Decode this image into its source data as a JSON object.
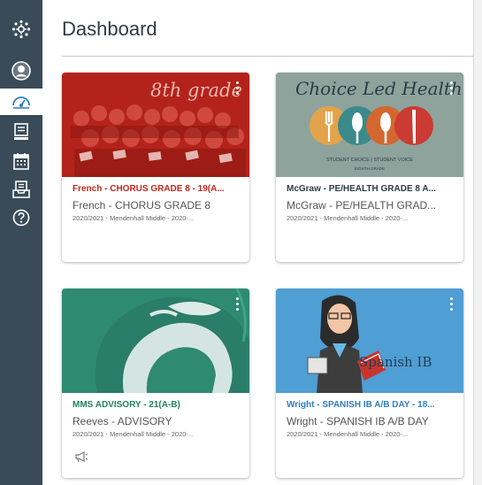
{
  "page_title": "Dashboard",
  "nav": {
    "items": [
      {
        "id": "logo",
        "icon": "logo-icon"
      },
      {
        "id": "account",
        "icon": "account-icon"
      },
      {
        "id": "dashboard",
        "icon": "dashboard-icon"
      },
      {
        "id": "courses",
        "icon": "courses-icon"
      },
      {
        "id": "calendar",
        "icon": "calendar-icon"
      },
      {
        "id": "inbox",
        "icon": "inbox-icon"
      },
      {
        "id": "help",
        "icon": "help-icon"
      }
    ]
  },
  "cards": [
    {
      "hero_color": "#b8241c",
      "hero_text": "8th grade",
      "short_name": "French - CHORUS GRADE 8 - 19(A...",
      "short_color": "#c0281c",
      "name": "French - CHORUS GRADE 8",
      "term": "2020/2021 - Mendenhall Middle - 2020-..."
    },
    {
      "hero_color": "#8fa49c",
      "hero_text": "Choice Led Health",
      "hero_sub": "STUDENT CHOICE | STUDENT VOICE",
      "hero_sub2": "EIGHTH GRADE",
      "short_name": "McGraw - PE/HEALTH GRADE 8 A...",
      "short_color": "#2d3b45",
      "name": "McGraw - PE/HEALTH GRAD...",
      "term": "2020/2021 - Mendenhall Middle - 2020-..."
    },
    {
      "hero_color": "#2f8a72",
      "short_name": "MMS ADVISORY - 21(A-B)",
      "short_color": "#22825f",
      "name": "Reeves - ADVISORY",
      "term": "2020/2021 - Mendenhall Middle - 2020-..."
    },
    {
      "hero_color": "#4e9dd3",
      "hero_text": "Spanish IB",
      "short_name": "Wright - SPANISH IB A/B DAY - 18...",
      "short_color": "#2f7fc4",
      "name": "Wright - SPANISH IB A/B DAY",
      "term": "2020/2021 - Mendenhall Middle - 2020-..."
    }
  ]
}
